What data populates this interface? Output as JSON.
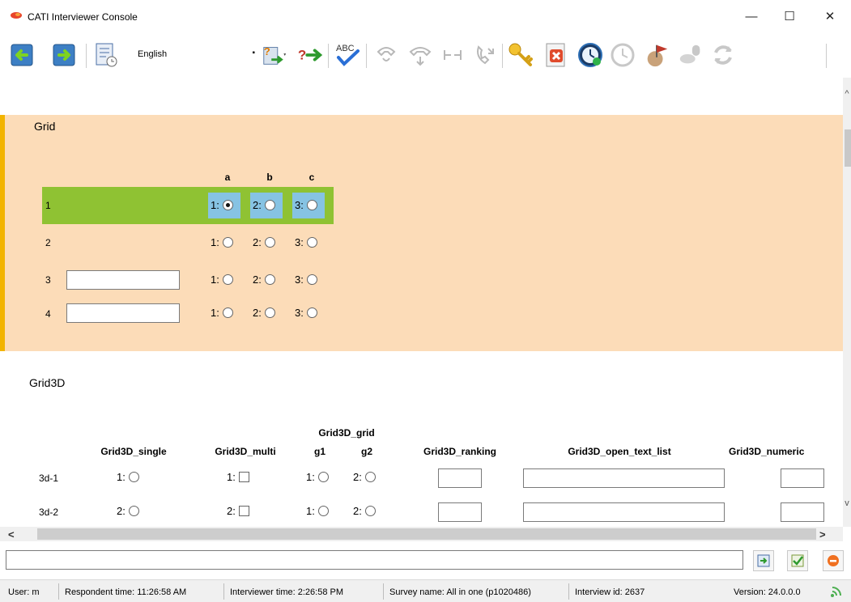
{
  "window": {
    "title": "CATI Interviewer Console",
    "minimize": "—",
    "maximize": "☐",
    "close": "✕"
  },
  "toolbar": {
    "language": "English",
    "spell_check_label": "ABC"
  },
  "grid": {
    "title": "Grid",
    "columns": [
      "a",
      "b",
      "c"
    ],
    "rows": [
      {
        "label": "1",
        "options": [
          "1:",
          "2:",
          "3:"
        ],
        "selected": 0
      },
      {
        "label": "2",
        "options": [
          "1:",
          "2:",
          "3:"
        ],
        "selected": -1
      },
      {
        "label": "3",
        "options": [
          "1:",
          "2:",
          "3:"
        ],
        "selected": -1
      },
      {
        "label": "4",
        "options": [
          "1:",
          "2:",
          "3:"
        ],
        "selected": -1
      }
    ]
  },
  "grid3d": {
    "title": "Grid3D",
    "headers": {
      "single": "Grid3D_single",
      "multi": "Grid3D_multi",
      "grid": "Grid3D_grid",
      "g1": "g1",
      "g2": "g2",
      "ranking": "Grid3D_ranking",
      "open_text": "Grid3D_open_text_list",
      "numeric": "Grid3D_numeric"
    },
    "rows": [
      {
        "label": "3d-1",
        "single": "1:",
        "multi": "1:",
        "g1": "1:",
        "g2": "2:"
      },
      {
        "label": "3d-2",
        "single": "2:",
        "multi": "2:",
        "g1": "1:",
        "g2": "2:"
      }
    ]
  },
  "scroll": {
    "left": "<",
    "right": ">",
    "up": "^",
    "down": "v"
  },
  "status": {
    "user": "User:  m",
    "respondent_time": "Respondent time:  11:26:58 AM",
    "interviewer_time": "Interviewer time:  2:26:58 PM",
    "survey_name": "Survey name:  All in one (p1020486)",
    "interview_id": "Interview id:  2637",
    "version": "Version:  24.0.0.0"
  },
  "colors": {
    "grid_bg": "#fcdcb8",
    "selected_row": "#8fc233",
    "selected_cell": "#86c3e3",
    "marker": "#f2b400"
  }
}
